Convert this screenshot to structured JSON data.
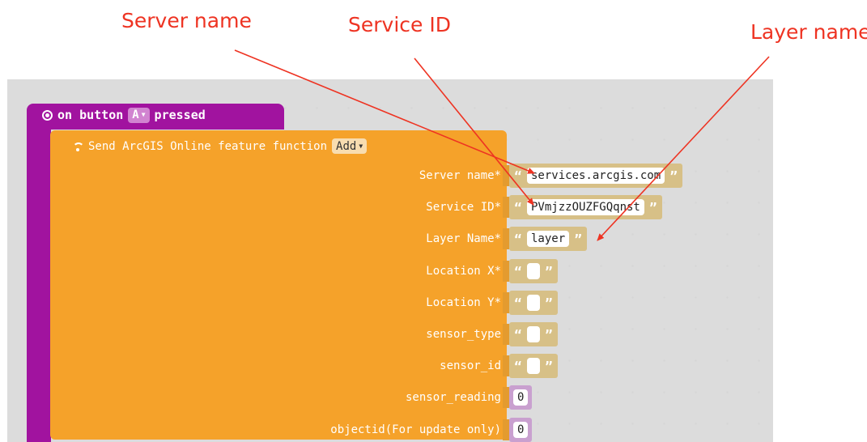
{
  "annotations": {
    "server_name": "Server name",
    "service_id": "Service ID",
    "layer_name": "Layer name"
  },
  "event_block": {
    "prefix": "on button",
    "button_value": "A",
    "suffix": "pressed",
    "icon": "gear-icon"
  },
  "function_block": {
    "label": "Send ArcGIS Online feature function",
    "mode": "Add",
    "icon": "wifi-icon",
    "color": "#f5a22a"
  },
  "params": [
    {
      "label": "Server name*",
      "type": "string",
      "value": "services.arcgis.com"
    },
    {
      "label": "Service ID*",
      "type": "string",
      "value": "PVmjzzOUZFGQqnst"
    },
    {
      "label": "Layer Name*",
      "type": "string",
      "value": "layer"
    },
    {
      "label": "Location X*",
      "type": "string",
      "value": ""
    },
    {
      "label": "Location Y*",
      "type": "string",
      "value": ""
    },
    {
      "label": "sensor_type",
      "type": "string",
      "value": ""
    },
    {
      "label": "sensor_id",
      "type": "string",
      "value": ""
    },
    {
      "label": "sensor_reading",
      "type": "number",
      "value": "0"
    },
    {
      "label": "objectid(For update only)",
      "type": "number",
      "value": "0"
    }
  ],
  "quote_open": "“",
  "quote_close": "”",
  "colors": {
    "event": "#a1139f",
    "annotation": "#ee3322",
    "string_block": "#d7c087",
    "number_block": "#c9a0cf"
  }
}
